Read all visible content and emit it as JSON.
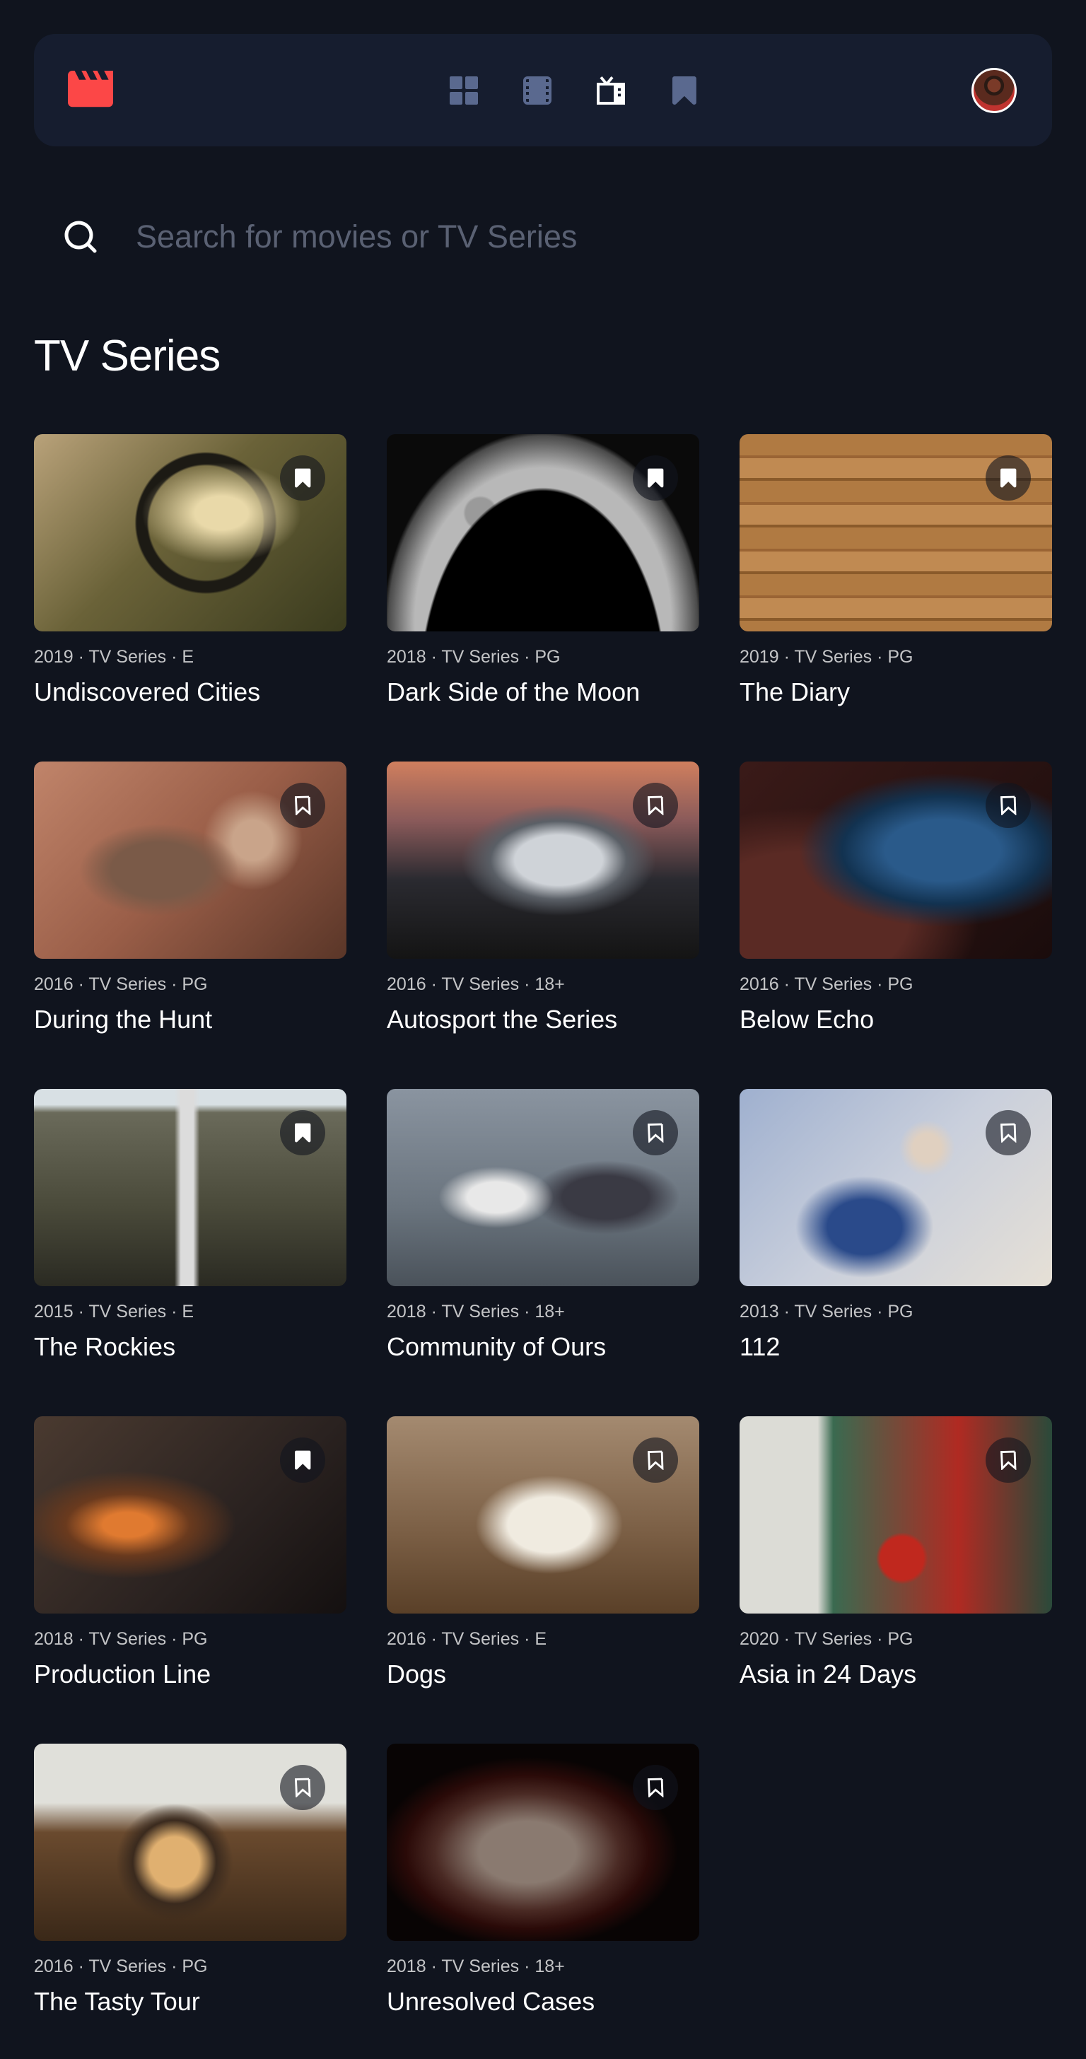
{
  "colors": {
    "background": "#10141e",
    "surface": "#161d2f",
    "accent": "#fc4747",
    "nav_icon_inactive": "#5a698f",
    "nav_icon_active": "#ffffff"
  },
  "nav": {
    "logo_icon": "movie-clapper-icon",
    "items": [
      {
        "icon": "home-grid-icon",
        "active": false
      },
      {
        "icon": "movies-film-icon",
        "active": false
      },
      {
        "icon": "tv-series-icon",
        "active": true
      },
      {
        "icon": "bookmark-icon",
        "active": false
      }
    ],
    "avatar_icon": "user-avatar"
  },
  "search": {
    "placeholder": "Search for movies or TV Series",
    "value": ""
  },
  "section": {
    "title": "TV Series"
  },
  "items": [
    {
      "year": "2019",
      "category": "TV Series",
      "rating": "E",
      "title": "Undiscovered Cities",
      "bookmarked": true
    },
    {
      "year": "2018",
      "category": "TV Series",
      "rating": "PG",
      "title": "Dark Side of the Moon",
      "bookmarked": true
    },
    {
      "year": "2019",
      "category": "TV Series",
      "rating": "PG",
      "title": "The Diary",
      "bookmarked": true
    },
    {
      "year": "2016",
      "category": "TV Series",
      "rating": "PG",
      "title": "During the Hunt",
      "bookmarked": false
    },
    {
      "year": "2016",
      "category": "TV Series",
      "rating": "18+",
      "title": "Autosport the Series",
      "bookmarked": false
    },
    {
      "year": "2016",
      "category": "TV Series",
      "rating": "PG",
      "title": "Below Echo",
      "bookmarked": false
    },
    {
      "year": "2015",
      "category": "TV Series",
      "rating": "E",
      "title": "The Rockies",
      "bookmarked": true
    },
    {
      "year": "2018",
      "category": "TV Series",
      "rating": "18+",
      "title": "Community of Ours",
      "bookmarked": false
    },
    {
      "year": "2013",
      "category": "TV Series",
      "rating": "PG",
      "title": "112",
      "bookmarked": false
    },
    {
      "year": "2018",
      "category": "TV Series",
      "rating": "PG",
      "title": "Production Line",
      "bookmarked": true
    },
    {
      "year": "2016",
      "category": "TV Series",
      "rating": "E",
      "title": "Dogs",
      "bookmarked": false
    },
    {
      "year": "2020",
      "category": "TV Series",
      "rating": "PG",
      "title": "Asia in 24 Days",
      "bookmarked": false
    },
    {
      "year": "2016",
      "category": "TV Series",
      "rating": "PG",
      "title": "The Tasty Tour",
      "bookmarked": false
    },
    {
      "year": "2018",
      "category": "TV Series",
      "rating": "18+",
      "title": "Unresolved Cases",
      "bookmarked": false
    }
  ]
}
